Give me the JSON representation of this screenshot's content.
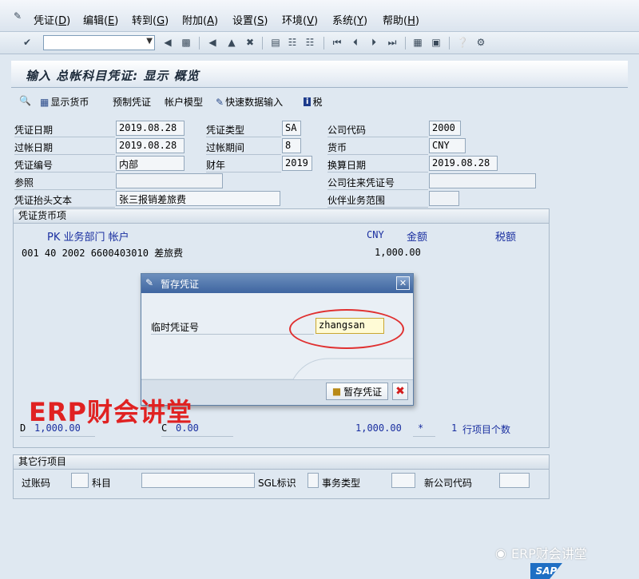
{
  "menu": {
    "items": [
      {
        "label": "凭证(",
        "key": "D",
        "tail": ")"
      },
      {
        "label": "编辑(",
        "key": "E",
        "tail": ")"
      },
      {
        "label": "转到(",
        "key": "G",
        "tail": ")"
      },
      {
        "label": "附加(",
        "key": "A",
        "tail": ")"
      },
      {
        "label": "设置(",
        "key": "S",
        "tail": ")"
      },
      {
        "label": "环境(",
        "key": "V",
        "tail": ")"
      },
      {
        "label": "系统(",
        "key": "Y",
        "tail": ")"
      },
      {
        "label": "帮助(",
        "key": "H",
        "tail": ")"
      }
    ]
  },
  "command_field": {
    "value": ""
  },
  "page": {
    "title": "输入 总帐科目凭证: 显示 概览"
  },
  "app_toolbar": {
    "display_currency": "显示货币",
    "park_document": "预制凭证",
    "account_model": "帐户模型",
    "fast_entry": "快速数据输入",
    "tax": "税"
  },
  "header": {
    "doc_date_label": "凭证日期",
    "doc_date": "2019.08.28",
    "doc_type_label": "凭证类型",
    "doc_type": "SA",
    "company_code_label": "公司代码",
    "company_code": "2000",
    "posting_date_label": "过帐日期",
    "posting_date": "2019.08.28",
    "period_label": "过帐期间",
    "period": "8",
    "currency_label": "货币",
    "currency": "CNY",
    "doc_number_label": "凭证编号",
    "doc_number": "内部",
    "fiscal_year_label": "财年",
    "fiscal_year": "2019",
    "translation_date_label": "换算日期",
    "translation_date": "2019.08.28",
    "reference_label": "参照",
    "reference": "",
    "cross_cc_label": "公司往来凭证号",
    "cross_cc": "",
    "header_text_label": "凭证抬头文本",
    "header_text": "张三报销差旅费",
    "trading_partner_label": "伙伴业务范围",
    "trading_partner": ""
  },
  "items": {
    "group_title": "凭证货币项",
    "col_header_left": "PK 业务部门 帐户",
    "col_currency": "CNY",
    "col_amount": "金额",
    "col_tax": "税额",
    "rows": [
      {
        "line": "001 40  2002 6600403010 差旅费",
        "amount": "1,000.00"
      }
    ],
    "footer_debit_flag": "D",
    "footer_debit": "1,000.00",
    "footer_credit_flag": "C",
    "footer_credit": "0.00",
    "footer_balance": "1,000.00",
    "footer_star": "*",
    "footer_count": "1",
    "footer_count_label": "行项目个数"
  },
  "other_items": {
    "group_title": "其它行项目",
    "posting_key_label": "过账码",
    "account_label": "科目",
    "sgl_label": "SGL标识",
    "trans_type_label": "事务类型",
    "new_cc_label": "新公司代码"
  },
  "dialog": {
    "title": "暂存凭证",
    "field_label": "临时凭证号",
    "field_value": "zhangsan",
    "hold_button": "暂存凭证"
  },
  "overlay": {
    "watermark": "ERP财会讲堂",
    "brand": "ERP财会讲堂",
    "sap_logo": "SAP"
  },
  "colors": {
    "highlight_ellipse": "#e03030",
    "watermark": "#e02222",
    "dialog_title": "#3e65a0"
  }
}
